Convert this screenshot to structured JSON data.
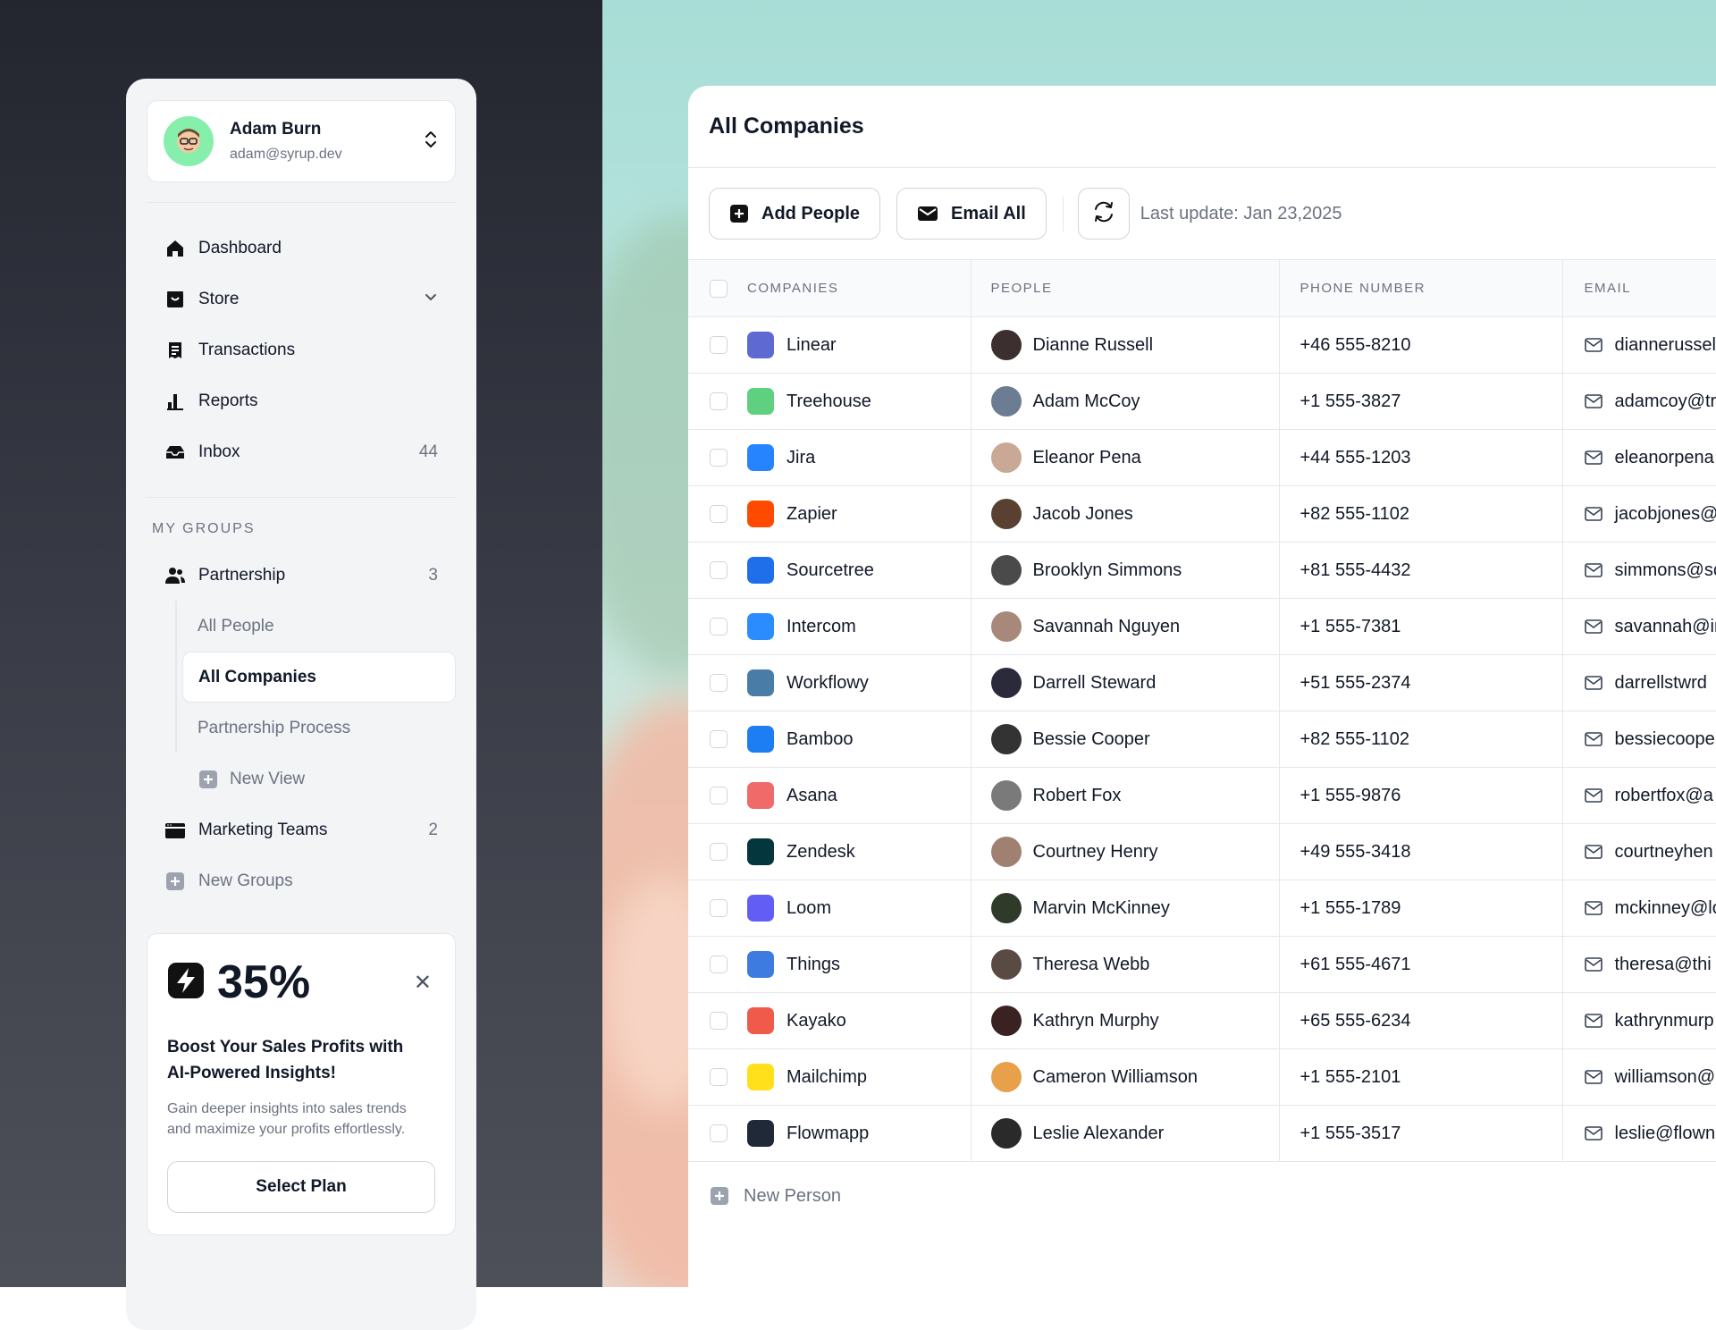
{
  "user": {
    "name": "Adam Burn",
    "email": "adam@syrup.dev"
  },
  "nav": [
    {
      "label": "Dashboard",
      "icon": "home-icon"
    },
    {
      "label": "Store",
      "icon": "store-icon",
      "expandable": true
    },
    {
      "label": "Transactions",
      "icon": "receipt-icon"
    },
    {
      "label": "Reports",
      "icon": "bar-chart-icon"
    },
    {
      "label": "Inbox",
      "icon": "inbox-icon",
      "count": "44"
    }
  ],
  "groups": {
    "title": "MY GROUPS",
    "partnership": {
      "label": "Partnership",
      "count": "3"
    },
    "sub_items": [
      "All People",
      "All Companies",
      "Partnership Process"
    ],
    "active_sub": "All Companies",
    "new_view": "New View",
    "marketing": {
      "label": "Marketing Teams",
      "count": "2"
    },
    "new_groups": "New Groups"
  },
  "promo": {
    "percent": "35%",
    "title_line1": "Boost Your Sales Profits with",
    "title_line2": "AI-Powered Insights!",
    "desc_line1": "Gain deeper insights into sales trends",
    "desc_line2": "and maximize your profits effortlessly.",
    "button": "Select Plan"
  },
  "main": {
    "title": "All Companies",
    "add_people": "Add People",
    "email_all": "Email All",
    "last_update": "Last update: Jan 23,2025",
    "columns": [
      "COMPANIES",
      "PEOPLE",
      "PHONE NUMBER",
      "EMAIL"
    ],
    "new_person": "New Person"
  },
  "rows": [
    {
      "company": "Linear",
      "person": "Dianne Russell",
      "phone": "+46 555-8210",
      "email": "diannerussell",
      "logo_color": "#5e6ad2",
      "avatar_color": "#3b2f2f"
    },
    {
      "company": "Treehouse",
      "person": "Adam McCoy",
      "phone": "+1 555-3827",
      "email": "adamcoy@tr",
      "logo_color": "#5fcf80",
      "avatar_color": "#6b7c93"
    },
    {
      "company": "Jira",
      "person": "Eleanor Pena",
      "phone": "+44 555-1203",
      "email": "eleanorpena",
      "logo_color": "#2684ff",
      "avatar_color": "#c9a995"
    },
    {
      "company": "Zapier",
      "person": "Jacob Jones",
      "phone": "+82 555-1102",
      "email": "jacobjones@",
      "logo_color": "#ff4a00",
      "avatar_color": "#5a4030"
    },
    {
      "company": "Sourcetree",
      "person": "Brooklyn Simmons",
      "phone": "+81 555-4432",
      "email": "simmons@sc",
      "logo_color": "#1f6feb",
      "avatar_color": "#4a4a4a"
    },
    {
      "company": "Intercom",
      "person": "Savannah Nguyen",
      "phone": "+1 555-7381",
      "email": "savannah@ir",
      "logo_color": "#2a8cff",
      "avatar_color": "#a8887a"
    },
    {
      "company": "Workflowy",
      "person": "Darrell Steward",
      "phone": "+51 555-2374",
      "email": "darrellstwrd",
      "logo_color": "#4a7ca8",
      "avatar_color": "#2a2a3a"
    },
    {
      "company": "Bamboo",
      "person": "Bessie Cooper",
      "phone": "+82 555-1102",
      "email": "bessiecoope",
      "logo_color": "#1c7ef2",
      "avatar_color": "#333333"
    },
    {
      "company": "Asana",
      "person": "Robert Fox",
      "phone": "+1 555-9876",
      "email": "robertfox@a",
      "logo_color": "#f06a6a",
      "avatar_color": "#7a7a7a"
    },
    {
      "company": "Zendesk",
      "person": "Courtney Henry",
      "phone": "+49 555-3418",
      "email": "courtneyhen",
      "logo_color": "#03363d",
      "avatar_color": "#a08070"
    },
    {
      "company": "Loom",
      "person": "Marvin McKinney",
      "phone": "+1 555-1789",
      "email": "mckinney@lo",
      "logo_color": "#625df5",
      "avatar_color": "#2f3a2a"
    },
    {
      "company": "Things",
      "person": "Theresa Webb",
      "phone": "+61 555-4671",
      "email": "theresa@thi",
      "logo_color": "#3d7be0",
      "avatar_color": "#5a4a44"
    },
    {
      "company": "Kayako",
      "person": "Kathryn Murphy",
      "phone": "+65 555-6234",
      "email": "kathrynmurp",
      "logo_color": "#f05a4a",
      "avatar_color": "#3a2222"
    },
    {
      "company": "Mailchimp",
      "person": "Cameron Williamson",
      "phone": "+1 555-2101",
      "email": "williamson@",
      "logo_color": "#ffe01b",
      "avatar_color": "#e8a04a"
    },
    {
      "company": "Flowmapp",
      "person": "Leslie Alexander",
      "phone": "+1 555-3517",
      "email": "leslie@flown",
      "logo_color": "#1f2937",
      "avatar_color": "#2a2a2a"
    }
  ],
  "colors": {
    "accent_dark": "#111827",
    "muted": "#6b7280",
    "border": "#e5e7eb",
    "avatar_bg": "#86efac"
  }
}
